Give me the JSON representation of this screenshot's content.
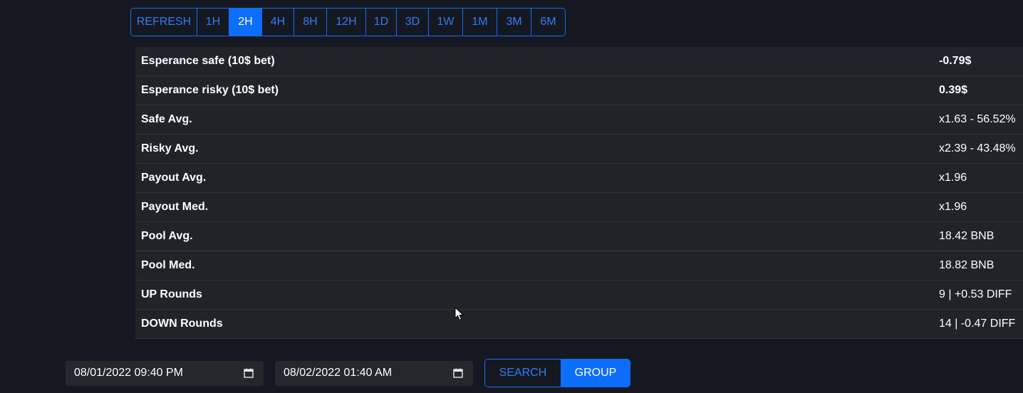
{
  "timeframes": {
    "refresh": "REFRESH",
    "items": [
      "1H",
      "2H",
      "4H",
      "8H",
      "12H",
      "1D",
      "3D",
      "1W",
      "1M",
      "3M",
      "6M"
    ],
    "active": "2H"
  },
  "stats": [
    {
      "label": "Esperance safe (10$ bet)",
      "value": "-0.79$"
    },
    {
      "label": "Esperance risky (10$ bet)",
      "value": "0.39$"
    },
    {
      "label": "Safe Avg.",
      "value": "x1.63 - 56.52%"
    },
    {
      "label": "Risky Avg.",
      "value": "x2.39 - 43.48%"
    },
    {
      "label": "Payout Avg.",
      "value": "x1.96"
    },
    {
      "label": "Payout Med.",
      "value": "x1.96"
    },
    {
      "label": "Pool Avg.",
      "value": "18.42 BNB"
    },
    {
      "label": "Pool Med.",
      "value": "18.82 BNB"
    },
    {
      "label": "UP Rounds",
      "value": "9 | +0.53 DIFF"
    },
    {
      "label": "DOWN Rounds",
      "value": "14 | -0.47 DIFF"
    }
  ],
  "filters": {
    "date_from": "08/01/2022 09:40  PM",
    "date_to": "08/02/2022 01:40  AM",
    "search_label": "SEARCH",
    "group_label": "GROUP"
  },
  "icons": {
    "calendar": "calendar-icon",
    "cursor": "mouse-pointer-icon"
  },
  "colors": {
    "background": "#161821",
    "panel": "#212329",
    "accent": "#0d6efd",
    "accent_text": "#2f7df6"
  }
}
